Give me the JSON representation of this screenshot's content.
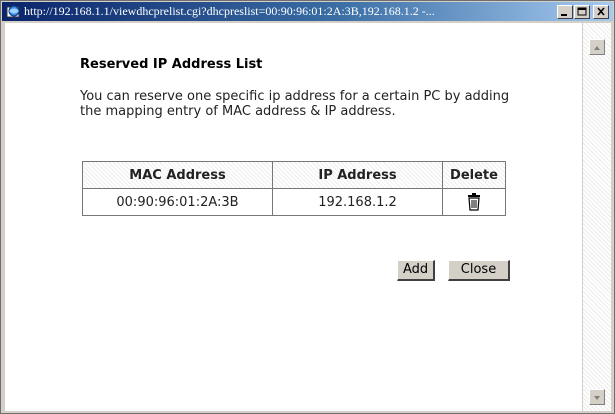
{
  "window": {
    "title": "http://192.168.1.1/viewdhcprelist.cgi?dhcpreslist=00:90:96:01:2A:3B,192.168.1.2 -..."
  },
  "page": {
    "heading": "Reserved IP Address List",
    "description": "You can reserve one specific ip address for a certain PC by adding the mapping entry of MAC address & IP address."
  },
  "table": {
    "headers": [
      "MAC Address",
      "IP Address",
      "Delete"
    ],
    "rows": [
      {
        "mac": "00:90:96:01:2A:3B",
        "ip": "192.168.1.2",
        "delete_icon": "trash-icon"
      }
    ]
  },
  "buttons": {
    "add": "Add",
    "close": "Close"
  },
  "colors": {
    "titlebar_start": "#0a246a",
    "titlebar_end": "#a6caf0",
    "chrome": "#d4d0c8"
  }
}
